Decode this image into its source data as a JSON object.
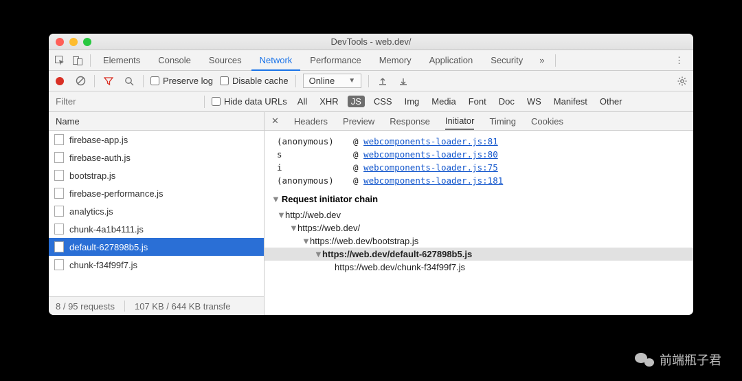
{
  "window": {
    "title": "DevTools - web.dev/"
  },
  "tabs": {
    "items": [
      "Elements",
      "Console",
      "Sources",
      "Network",
      "Performance",
      "Memory",
      "Application",
      "Security"
    ],
    "more": "»",
    "active": "Network"
  },
  "toolbar": {
    "preserve_log": "Preserve log",
    "disable_cache": "Disable cache",
    "throttle": "Online"
  },
  "filterbar": {
    "placeholder": "Filter",
    "hide_data_urls": "Hide data URLs",
    "types": [
      "All",
      "XHR",
      "JS",
      "CSS",
      "Img",
      "Media",
      "Font",
      "Doc",
      "WS",
      "Manifest",
      "Other"
    ],
    "selected": "JS"
  },
  "name_column": "Name",
  "requests": [
    "firebase-app.js",
    "firebase-auth.js",
    "bootstrap.js",
    "firebase-performance.js",
    "analytics.js",
    "chunk-4a1b4111.js",
    "default-627898b5.js",
    "chunk-f34f99f7.js"
  ],
  "selected_request": "default-627898b5.js",
  "status": {
    "requests": "8 / 95 requests",
    "transfer": "107 KB / 644 KB transfe"
  },
  "subtabs": {
    "items": [
      "Headers",
      "Preview",
      "Response",
      "Initiator",
      "Timing",
      "Cookies"
    ],
    "active": "Initiator"
  },
  "stack": [
    {
      "fn": "(anonymous)",
      "at": "@",
      "link": "webcomponents-loader.js:81"
    },
    {
      "fn": "s",
      "at": "@",
      "link": "webcomponents-loader.js:80"
    },
    {
      "fn": "i",
      "at": "@",
      "link": "webcomponents-loader.js:75"
    },
    {
      "fn": "(anonymous)",
      "at": "@",
      "link": "webcomponents-loader.js:181"
    }
  ],
  "chain": {
    "title": "Request initiator chain",
    "nodes": [
      {
        "depth": 0,
        "label": "http://web.dev",
        "arrow": true
      },
      {
        "depth": 1,
        "label": "https://web.dev/",
        "arrow": true
      },
      {
        "depth": 2,
        "label": "https://web.dev/bootstrap.js",
        "arrow": true
      },
      {
        "depth": 3,
        "label": "https://web.dev/default-627898b5.js",
        "arrow": true,
        "hl": true
      },
      {
        "depth": 4,
        "label": "https://web.dev/chunk-f34f99f7.js",
        "arrow": false
      }
    ]
  },
  "watermark": "前端瓶子君"
}
